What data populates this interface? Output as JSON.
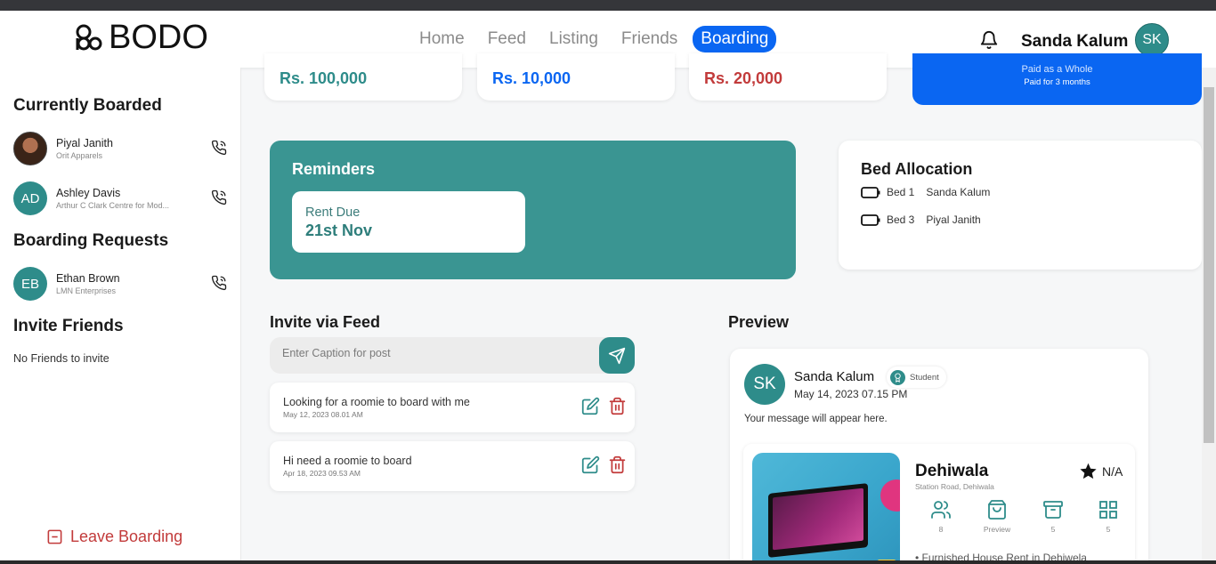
{
  "brand": {
    "name": "BODO"
  },
  "nav": {
    "items": [
      {
        "label": "Home",
        "active": false
      },
      {
        "label": "Feed",
        "active": false
      },
      {
        "label": "Listing",
        "active": false
      },
      {
        "label": "Friends",
        "active": false
      },
      {
        "label": "Boarding",
        "active": true
      }
    ],
    "accent_color": "#0a66f2"
  },
  "user": {
    "name": "Sanda Kalum",
    "initials": "SK",
    "avatar_color": "#2e8c8a"
  },
  "sidebar": {
    "currently_boarded_title": "Currently Boarded",
    "boarded": [
      {
        "name": "Piyal Janith",
        "org": "Orit Apparels",
        "initials": "",
        "photo": true
      },
      {
        "name": "Ashley Davis",
        "org": "Arthur C Clark Centre for Mod...",
        "initials": "AD",
        "photo": false
      }
    ],
    "requests_title": "Boarding Requests",
    "requests": [
      {
        "name": "Ethan Brown",
        "org": "LMN Enterprises",
        "initials": "EB"
      }
    ],
    "invite_title": "Invite Friends",
    "no_friends": "No Friends to invite",
    "leave_label": "Leave Boarding"
  },
  "stats": [
    {
      "value": "Rs. 100,000",
      "color": "#2e8c8a"
    },
    {
      "value": "Rs. 10,000",
      "color": "#0a66f2"
    },
    {
      "value": "Rs. 20,000",
      "color": "#c23b3b"
    }
  ],
  "payment": {
    "line1": "Paid as a Whole",
    "line2": "Paid for 3 months"
  },
  "reminders": {
    "title": "Reminders",
    "items": [
      {
        "label": "Rent Due",
        "value": "21st Nov"
      }
    ]
  },
  "beds": {
    "title": "Bed Allocation",
    "items": [
      {
        "bed": "Bed 1",
        "name": "Sanda Kalum"
      },
      {
        "bed": "Bed 3",
        "name": "Piyal Janith"
      }
    ]
  },
  "invite": {
    "title": "Invite via Feed",
    "placeholder": "Enter Caption for post",
    "posts": [
      {
        "text": "Looking for a roomie to board with me",
        "date": "May 12, 2023 08.01 AM"
      },
      {
        "text": "Hi need a roomie to board",
        "date": "Apr 18, 2023 09.53 AM"
      }
    ]
  },
  "preview": {
    "title": "Preview",
    "author": "Sanda Kalum",
    "initials": "SK",
    "badge": "Student",
    "date": "May 14, 2023 07.15 PM",
    "message": "Your message will appear here.",
    "listing": {
      "title": "Dehiwala",
      "address": "Station Road, Dehiwala",
      "rating": "N/A",
      "amenities": [
        {
          "icon": "people-icon",
          "value": "8"
        },
        {
          "icon": "bag-icon",
          "value": "Preview"
        },
        {
          "icon": "archive-icon",
          "value": "5"
        },
        {
          "icon": "grid-icon",
          "value": "5"
        }
      ],
      "bullet": "Furnished House Rent in Dehiwela"
    }
  }
}
